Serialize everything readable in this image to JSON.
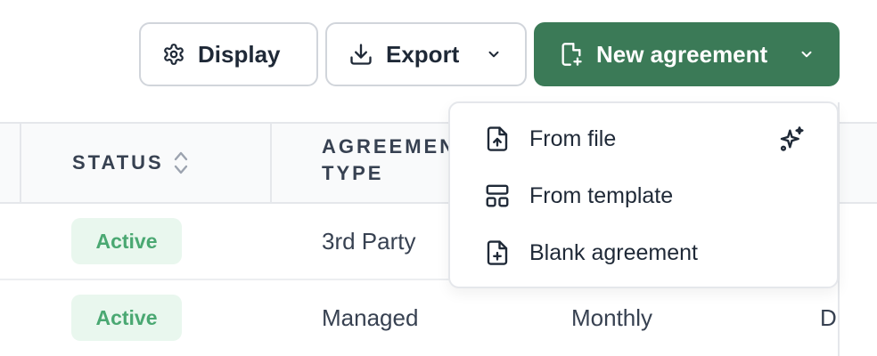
{
  "toolbar": {
    "display_label": "Display",
    "export_label": "Export",
    "new_agreement_label": "New agreement"
  },
  "table": {
    "headers": {
      "status": "STATUS",
      "agreement_type_line1": "AGREEMENT",
      "agreement_type_line2": "TYPE"
    },
    "rows": [
      {
        "status": "Active",
        "type": "3rd Party"
      },
      {
        "status": "Active",
        "type": "Managed",
        "frequency": "Monthly",
        "next": "D"
      }
    ]
  },
  "menu": {
    "items": [
      {
        "label": "From file",
        "icon": "file-upload-icon",
        "badge_icon": "sparkles-icon"
      },
      {
        "label": "From template",
        "icon": "template-layout-icon"
      },
      {
        "label": "Blank agreement",
        "icon": "file-plus-icon"
      }
    ]
  },
  "colors": {
    "primary": "#3b7a57",
    "status_active_bg": "#e9f7ee",
    "status_active_text": "#4aa872"
  }
}
